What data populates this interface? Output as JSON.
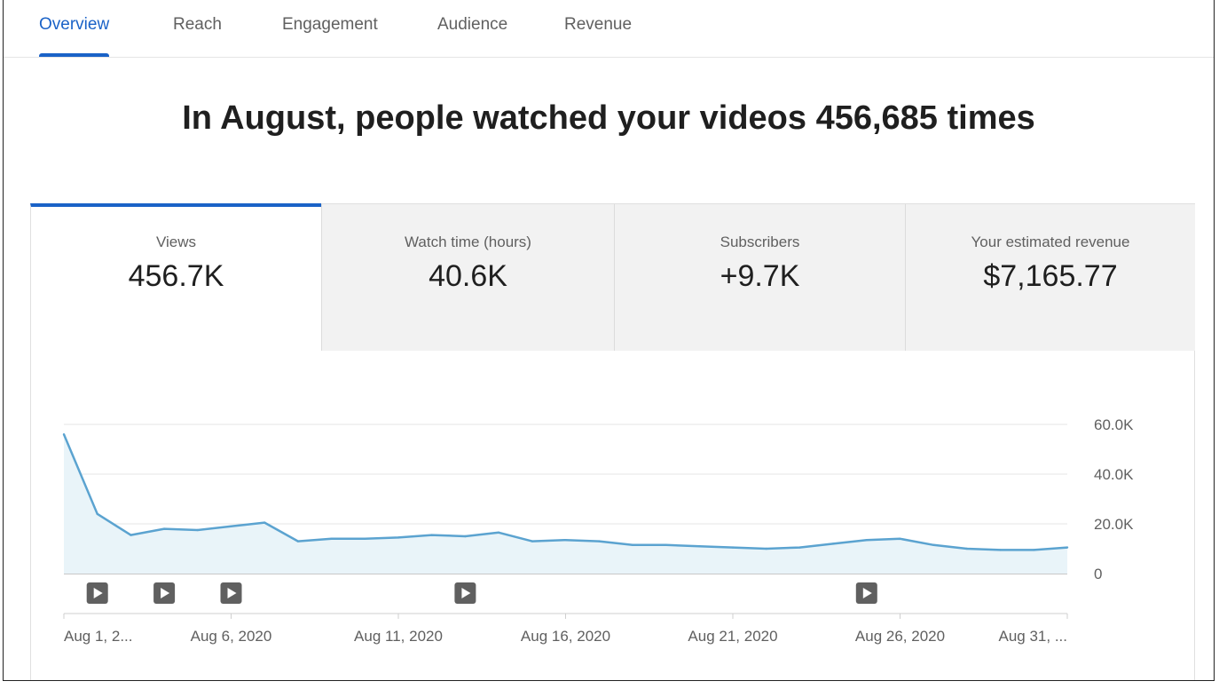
{
  "tabs": [
    {
      "label": "Overview",
      "active": true
    },
    {
      "label": "Reach",
      "active": false
    },
    {
      "label": "Engagement",
      "active": false
    },
    {
      "label": "Audience",
      "active": false
    },
    {
      "label": "Revenue",
      "active": false
    }
  ],
  "headline": "In August, people watched your videos 456,685 times",
  "metrics": [
    {
      "label": "Views",
      "value": "456.7K",
      "active": true
    },
    {
      "label": "Watch time (hours)",
      "value": "40.6K",
      "active": false
    },
    {
      "label": "Subscribers",
      "value": "+9.7K",
      "active": false
    },
    {
      "label": "Your estimated revenue",
      "value": "$7,165.77",
      "active": false
    }
  ],
  "colors": {
    "accent": "#1a62c7",
    "line": "#5ba3d0",
    "area": "#e9f4f9"
  },
  "chart_data": {
    "type": "area",
    "series": [
      {
        "values": [
          56000,
          24000,
          15500,
          18000,
          17500,
          19000,
          20500,
          13000,
          14000,
          14000,
          14500,
          15500,
          15000,
          16500,
          13000,
          13500,
          13000,
          11500,
          11500,
          11000,
          10500,
          10000,
          10500,
          12000,
          13500,
          14000,
          11500,
          10000,
          9500,
          9500,
          10500
        ]
      }
    ],
    "x": [
      "Aug 1",
      "Aug 2",
      "Aug 3",
      "Aug 4",
      "Aug 5",
      "Aug 6",
      "Aug 7",
      "Aug 8",
      "Aug 9",
      "Aug 10",
      "Aug 11",
      "Aug 12",
      "Aug 13",
      "Aug 14",
      "Aug 15",
      "Aug 16",
      "Aug 17",
      "Aug 18",
      "Aug 19",
      "Aug 20",
      "Aug 21",
      "Aug 22",
      "Aug 23",
      "Aug 24",
      "Aug 25",
      "Aug 26",
      "Aug 27",
      "Aug 28",
      "Aug 29",
      "Aug 30",
      "Aug 31"
    ],
    "ylim": [
      0,
      60000
    ],
    "y_ticks": [
      {
        "value": 0,
        "label": "0"
      },
      {
        "value": 20000,
        "label": "20.0K"
      },
      {
        "value": 40000,
        "label": "40.0K"
      },
      {
        "value": 60000,
        "label": "60.0K"
      }
    ],
    "x_ticks": [
      {
        "index": 0,
        "label": "Aug 1, 2..."
      },
      {
        "index": 5,
        "label": "Aug 6, 2020"
      },
      {
        "index": 10,
        "label": "Aug 11, 2020"
      },
      {
        "index": 15,
        "label": "Aug 16, 2020"
      },
      {
        "index": 20,
        "label": "Aug 21, 2020"
      },
      {
        "index": 25,
        "label": "Aug 26, 2020"
      },
      {
        "index": 30,
        "label": "Aug 31, ..."
      }
    ],
    "video_markers": [
      1,
      3,
      5,
      12,
      24
    ],
    "grid": true
  }
}
